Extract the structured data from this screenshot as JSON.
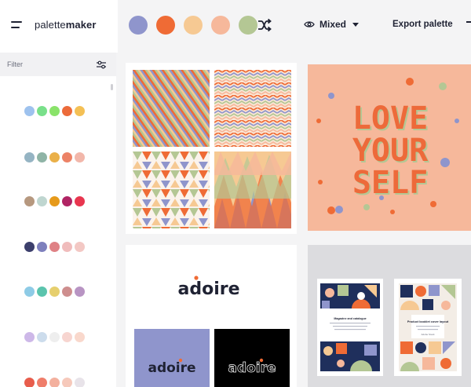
{
  "brand": {
    "light": "palette",
    "bold": "maker"
  },
  "palette": {
    "colors": [
      "#8f95cc",
      "#ef6b35",
      "#f6c993",
      "#f6b89b",
      "#b4c794"
    ]
  },
  "toolbar": {
    "mode_label": "Mixed",
    "export_label": "Export palette"
  },
  "sidebar": {
    "filter_label": "Filter",
    "palettes": [
      [
        "#9ec2ee",
        "#79e08a",
        "#8ae36a",
        "#ec6b3a",
        "#f4c055"
      ],
      [
        "#95b4c3",
        "#8fb4a6",
        "#eab049",
        "#ec8266",
        "#f2b7aa"
      ],
      [
        "#b6987f",
        "#bfd6d0",
        "#e69a1b",
        "#b02464",
        "#e8364f"
      ],
      [
        "#3c3f6c",
        "#7e80bd",
        "#df8185",
        "#f0bcbc",
        "#f3c8c4"
      ],
      [
        "#8ecbe6",
        "#5bc4ad",
        "#e6cf6e",
        "#ce8e8e",
        "#b894c3"
      ],
      [
        "#cdb8e8",
        "#ccdcec",
        "#eeeeee",
        "#f7d5d0",
        "#f9d8cc"
      ],
      [
        "#e85d4c",
        "#ef7d6a",
        "#f3b09e",
        "#f6c9bb",
        "#e8e3e9"
      ]
    ]
  },
  "gallery": {
    "poster": {
      "line1": "LOVE",
      "line2": "YOUR",
      "line3": "SELF"
    },
    "brand_card": {
      "wordmark": "adoire"
    },
    "brochure": {
      "title": "Magazine and catalogue",
      "title2": "Product booklet cover layout",
      "foot": "Adobe Stock"
    }
  }
}
